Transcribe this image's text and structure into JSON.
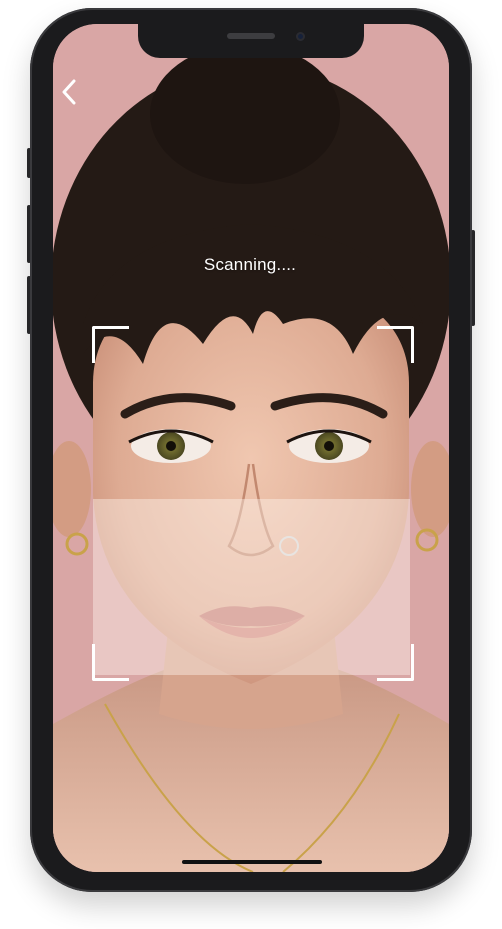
{
  "screen": {
    "back_button": {
      "icon": "chevron-left-icon"
    },
    "status_text": "Scanning....",
    "scan_frame": {
      "corner_color": "#ffffff"
    },
    "photo": {
      "subject": "face-portrait",
      "background_color": "#d9a6a5"
    }
  },
  "device": {
    "frame_color": "#1b1b1d",
    "home_indicator": {
      "icon": "home-indicator"
    }
  }
}
